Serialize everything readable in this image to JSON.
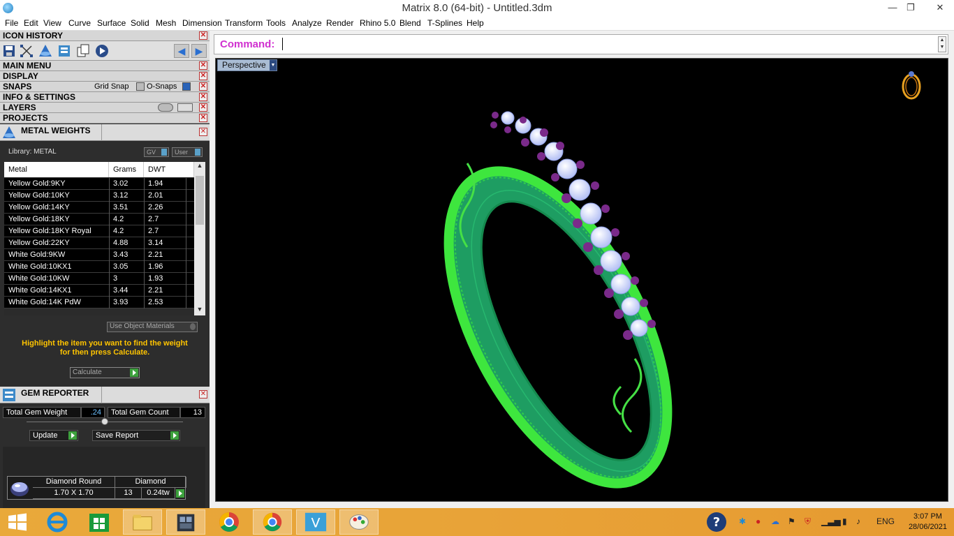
{
  "window": {
    "title": "Matrix 8.0 (64-bit) - Untitled.3dm",
    "minimize_glyph": "—",
    "restore_glyph": "❐",
    "close_glyph": "✕"
  },
  "menu": [
    "File",
    "Edit",
    "View",
    "Curve",
    "Surface",
    "Solid",
    "Mesh",
    "Dimension",
    "Transform",
    "Tools",
    "Analyze",
    "Render",
    "Rhino 5.0",
    "Blend",
    "T-Splines",
    "Help"
  ],
  "sections": {
    "icon_history": "ICON HISTORY",
    "main_menu": "MAIN MENU",
    "display": "DISPLAY",
    "snaps": "SNAPS",
    "grid_snap": "Grid Snap",
    "o_snaps": "O-Snaps",
    "info_settings": "INFO & SETTINGS",
    "layers": "LAYERS",
    "projects": "PROJECTS"
  },
  "metal_weights": {
    "title": "METAL WEIGHTS",
    "library": "Library: METAL",
    "gv_label": "GV",
    "user_label": "User",
    "columns": [
      "Metal",
      "Grams",
      "DWT"
    ],
    "rows": [
      [
        "Yellow Gold:9KY",
        "3.02",
        "1.94"
      ],
      [
        "Yellow Gold:10KY",
        "3.12",
        "2.01"
      ],
      [
        "Yellow Gold:14KY",
        "3.51",
        "2.26"
      ],
      [
        "Yellow Gold:18KY",
        "4.2",
        "2.7"
      ],
      [
        "Yellow Gold:18KY Royal",
        "4.2",
        "2.7"
      ],
      [
        "Yellow Gold:22KY",
        "4.88",
        "3.14"
      ],
      [
        "White Gold:9KW",
        "3.43",
        "2.21"
      ],
      [
        "White Gold:10KX1",
        "3.05",
        "1.96"
      ],
      [
        "White Gold:10KW",
        "3",
        "1.93"
      ],
      [
        "White Gold:14KX1",
        "3.44",
        "2.21"
      ],
      [
        "White Gold:14K PdW",
        "3.93",
        "2.53"
      ]
    ],
    "use_object_materials": "Use Object Materials",
    "hint_line1": "Highlight the item you want to find the weight",
    "hint_line2": "for then press Calculate.",
    "calculate": "Calculate"
  },
  "gem_reporter": {
    "title": "GEM REPORTER",
    "total_weight_label": "Total Gem Weight",
    "total_weight_value": ".24",
    "total_count_label": "Total Gem Count",
    "total_count_value": "13",
    "update": "Update",
    "save_report": "Save Report",
    "gem_name": "Diamond Round",
    "gem_type": "Diamond",
    "gem_size": "1.70 X 1.70",
    "gem_count": "13",
    "gem_weight": "0.24tw"
  },
  "command": {
    "label": "Command:"
  },
  "viewport": {
    "name": "Perspective"
  },
  "taskbar": {
    "language": "ENG",
    "time": "3:07 PM",
    "date": "28/06/2021"
  },
  "colors": {
    "ring_band": "#1f9a5a",
    "ring_edge": "#3ee63e",
    "gems": "#c8d4ff",
    "prongs": "#7a2a8a",
    "accent_magenta": "#d030d0",
    "hint_yellow": "#ffc400"
  }
}
